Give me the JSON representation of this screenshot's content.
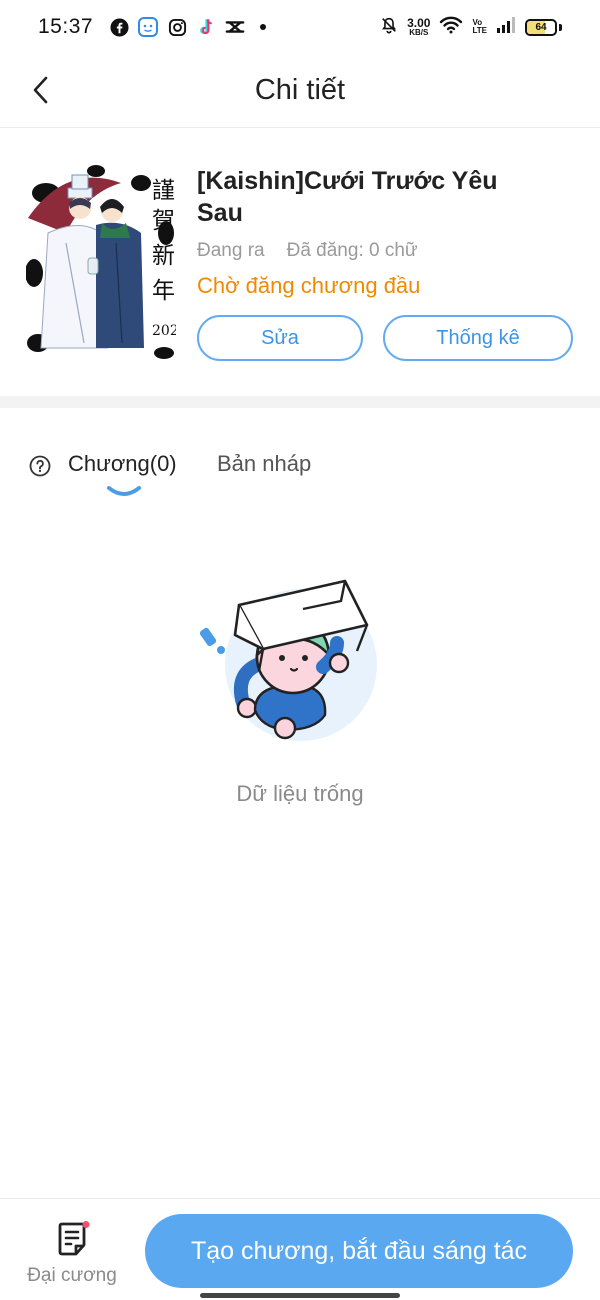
{
  "status_bar": {
    "time": "15:37",
    "speed_value": "3.00",
    "speed_unit": "KB/S",
    "volte_top": "Vo",
    "volte_bottom": "LTE",
    "battery": "64",
    "apps": [
      "facebook-icon",
      "messenger-kids-icon",
      "instagram-icon",
      "tiktok-icon",
      "capcut-icon"
    ]
  },
  "header": {
    "title": "Chi tiết"
  },
  "book": {
    "title": "[Kaishin]Cưới Trước Yêu Sau",
    "state": "Đang ra",
    "published": "Đã đăng: 0 chữ",
    "status": "Chờ đăng chương đầu",
    "edit_label": "Sửa",
    "stats_label": "Thống kê"
  },
  "tabs": {
    "chapters": "Chương(0)",
    "drafts": "Bản nháp"
  },
  "empty": {
    "text": "Dữ liệu trống"
  },
  "bottom": {
    "outline_label": "Đại cương",
    "create_label": "Tạo chương, bắt đầu sáng tác"
  },
  "colors": {
    "accent": "#5aa8f0",
    "status_orange": "#f08a00"
  }
}
